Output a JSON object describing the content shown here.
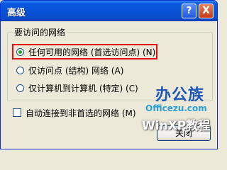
{
  "window": {
    "title": "高级",
    "help_label": "?",
    "close_label": "X"
  },
  "group": {
    "title": "要访问的网络",
    "options": [
      {
        "label": "任何可用的网络 (首选访问点) (N)",
        "selected": true
      },
      {
        "label": "仅访问点 (结构) 网络 (A)",
        "selected": false
      },
      {
        "label": "仅计算机到计算机 (特定) (C)",
        "selected": false
      }
    ]
  },
  "auto_connect": {
    "label": "自动连接到非首选的网络 (M)",
    "checked": false
  },
  "ok_button": {
    "label": "关闭"
  },
  "watermark": {
    "logo": "办公族",
    "site": "Officezu.com",
    "brand": "WinXP教程"
  },
  "colors": {
    "titlebar": "#0852d6",
    "highlight_border": "#e01010",
    "dialog_bg": "#ece9d8"
  }
}
